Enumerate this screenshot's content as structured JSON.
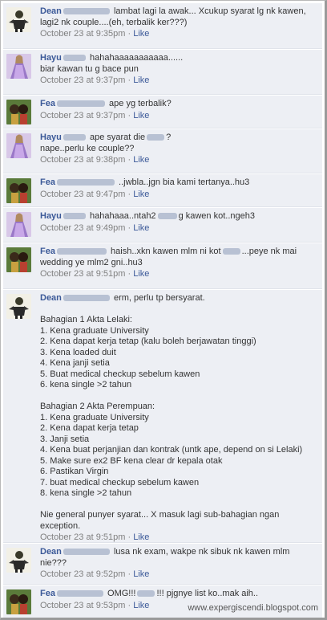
{
  "comments": [
    {
      "author": "Dean",
      "avatar": "dean-avatar",
      "text": "lambat lagi la awak... Xcukup syarat lg nk kawen, lagi2 nk couple....(eh, terbalik ker???)",
      "time": "October 23 at 9:35pm",
      "like": "Like"
    },
    {
      "author": "Hayu",
      "avatar": "hayu-avatar",
      "text": "hahahaaaaaaaaaaa......\nbiar kawan tu g bace pun",
      "time": "October 23 at 9:37pm",
      "like": "Like"
    },
    {
      "author": "Fea",
      "avatar": "fea-avatar",
      "text": "ape yg terbalik?",
      "time": "October 23 at 9:37pm",
      "like": "Like"
    },
    {
      "author": "Hayu",
      "avatar": "hayu-avatar",
      "text": "ape syarat die",
      "text2": "?\nnape..perlu ke couple??",
      "time": "October 23 at 9:38pm",
      "like": "Like"
    },
    {
      "author": "Fea",
      "avatar": "fea-avatar",
      "text": "..jwbla..jgn bia kami tertanya..hu3",
      "time": "October 23 at 9:47pm",
      "like": "Like"
    },
    {
      "author": "Hayu",
      "avatar": "hayu-avatar",
      "text": "hahahaaa..ntah2",
      "text2": "g kawen kot..ngeh3",
      "time": "October 23 at 9:49pm",
      "like": "Like"
    },
    {
      "author": "Fea",
      "avatar": "fea-avatar",
      "text": "haish..xkn kawen mlm ni kot",
      "text2": "...peye nk mai wedding ye mlm2 gni..hu3",
      "time": "October 23 at 9:51pm",
      "like": "Like"
    },
    {
      "author": "Dean",
      "avatar": "dean-avatar",
      "text": "erm, perlu tp bersyarat.\n\nBahagian 1 Akta Lelaki:\n1. Kena graduate University\n2. Kena dapat kerja tetap (kalu boleh berjawatan tinggi)\n3. Kena loaded duit\n4. Kena janji setia\n5. Buat medical checkup sebelum kawen\n6. kena single >2 tahun\n\nBahagian 2 Akta Perempuan:\n1. Kena graduate University\n2. Kena dapat kerja tetap\n3. Janji setia\n4. Kena buat perjanjian dan kontrak (untk ape, depend on si Lelaki)\n5. Make sure ex2 BF kena clear dr kepala otak\n6. Pastikan Virgin\n7. buat medical checkup sebelum kawen\n8. kena single >2 tahun\n\nNie general punyer syarat... X masuk lagi sub-bahagian ngan exception.",
      "time": "October 23 at 9:51pm",
      "like": "Like"
    },
    {
      "author": "Dean",
      "avatar": "dean-avatar",
      "text": "lusa nk exam, wakpe nk sibuk nk kawen mlm nie???",
      "time": "October 23 at 9:52pm",
      "like": "Like"
    },
    {
      "author": "Fea",
      "avatar": "fea-avatar",
      "text": "OMG!!!",
      "text2": "!!! pjgnye list ko..mak aih..",
      "time": "October 23 at 9:53pm",
      "like": "Like"
    }
  ],
  "separator": " · ",
  "watermark": "www.expergiscendi.blogspot.com",
  "colors": {
    "comment_bg": "#edeff4",
    "author": "#3b5998",
    "meta": "#808080"
  }
}
